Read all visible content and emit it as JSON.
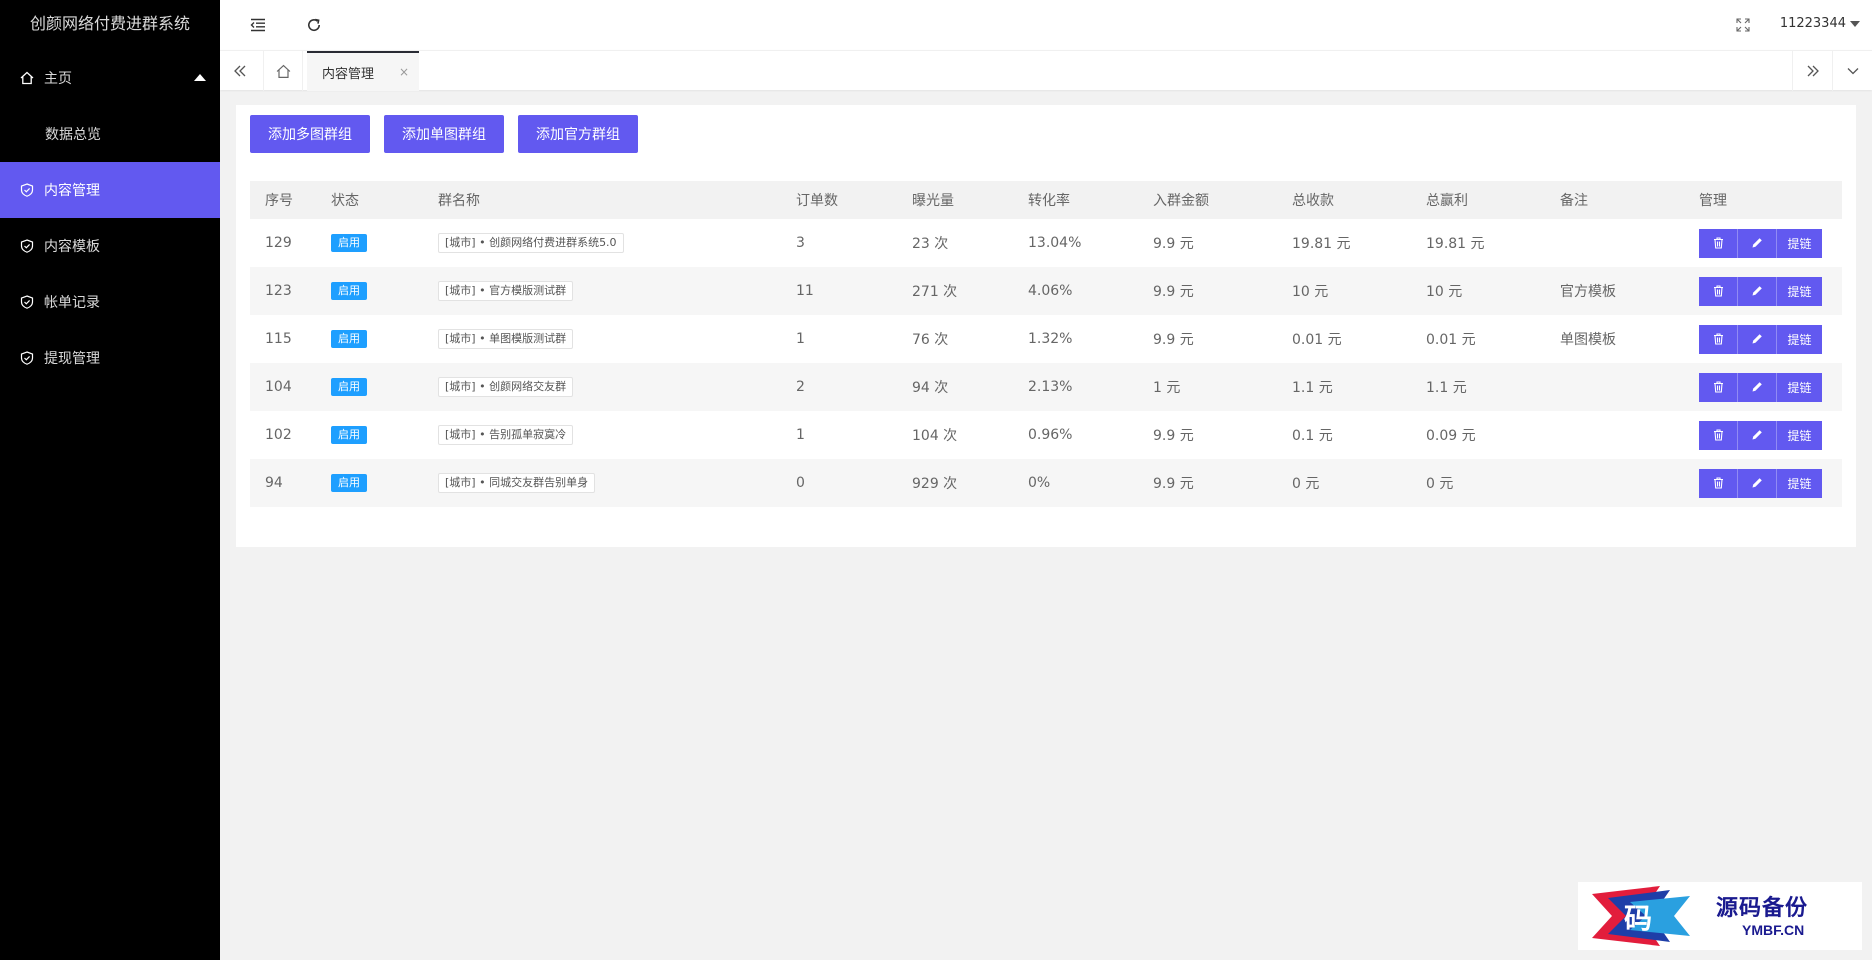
{
  "app": {
    "title": "创颜网络付费进群系统"
  },
  "sidebar": {
    "home": "主页",
    "sub_overview": "数据总览",
    "items": [
      {
        "label": "内容管理",
        "active": true
      },
      {
        "label": "内容模板",
        "active": false
      },
      {
        "label": "帐单记录",
        "active": false
      },
      {
        "label": "提现管理",
        "active": false
      }
    ]
  },
  "header": {
    "user": "11223344"
  },
  "tabs": {
    "active_label": "内容管理",
    "close_glyph": "×"
  },
  "toolbar": {
    "btn_multi": "添加多图群组",
    "btn_single": "添加单图群组",
    "btn_official": "添加官方群组"
  },
  "table": {
    "columns": [
      "序号",
      "状态",
      "群名称",
      "订单数",
      "曝光量",
      "转化率",
      "入群金额",
      "总收款",
      "总赢利",
      "备注",
      "管理"
    ],
    "rows": [
      {
        "id": "129",
        "status": "启用",
        "name": "[城市] • 创颜网络付费进群系统5.0",
        "orders": "3",
        "views": "23 次",
        "rate": "13.04%",
        "fee": "9.9 元",
        "total": "19.81 元",
        "profit": "19.81 元",
        "note": ""
      },
      {
        "id": "123",
        "status": "启用",
        "name": "[城市] • 官方模版测试群",
        "orders": "11",
        "views": "271 次",
        "rate": "4.06%",
        "fee": "9.9 元",
        "total": "10 元",
        "profit": "10 元",
        "note": "官方模板"
      },
      {
        "id": "115",
        "status": "启用",
        "name": "[城市] • 单图模版测试群",
        "orders": "1",
        "views": "76 次",
        "rate": "1.32%",
        "fee": "9.9 元",
        "total": "0.01 元",
        "profit": "0.01 元",
        "note": "单图模板"
      },
      {
        "id": "104",
        "status": "启用",
        "name": "[城市] • 创颜网络交友群",
        "orders": "2",
        "views": "94 次",
        "rate": "2.13%",
        "fee": "1 元",
        "total": "1.1 元",
        "profit": "1.1 元",
        "note": ""
      },
      {
        "id": "102",
        "status": "启用",
        "name": "[城市] • 告别孤单寂寞冷",
        "orders": "1",
        "views": "104 次",
        "rate": "0.96%",
        "fee": "9.9 元",
        "total": "0.1 元",
        "profit": "0.09 元",
        "note": ""
      },
      {
        "id": "94",
        "status": "启用",
        "name": "[城市] • 同城交友群告别单身",
        "orders": "0",
        "views": "929 次",
        "rate": "0%",
        "fee": "9.9 元",
        "total": "0 元",
        "profit": "0 元",
        "note": ""
      }
    ],
    "op_link": "提链"
  },
  "watermark": {
    "cn": "源码备份",
    "en": "YMBF.CN",
    "glyph": "码"
  },
  "colors": {
    "accent": "#6259f0",
    "badge": "#1e9fff",
    "sidebar_bg": "#000000"
  },
  "icons": [
    "home-icon",
    "shield-check-icon",
    "menu-fold-icon",
    "refresh-icon",
    "fullscreen-icon",
    "double-chevron-left-icon",
    "double-chevron-right-icon",
    "chevron-down-icon",
    "trash-icon",
    "pencil-icon"
  ]
}
